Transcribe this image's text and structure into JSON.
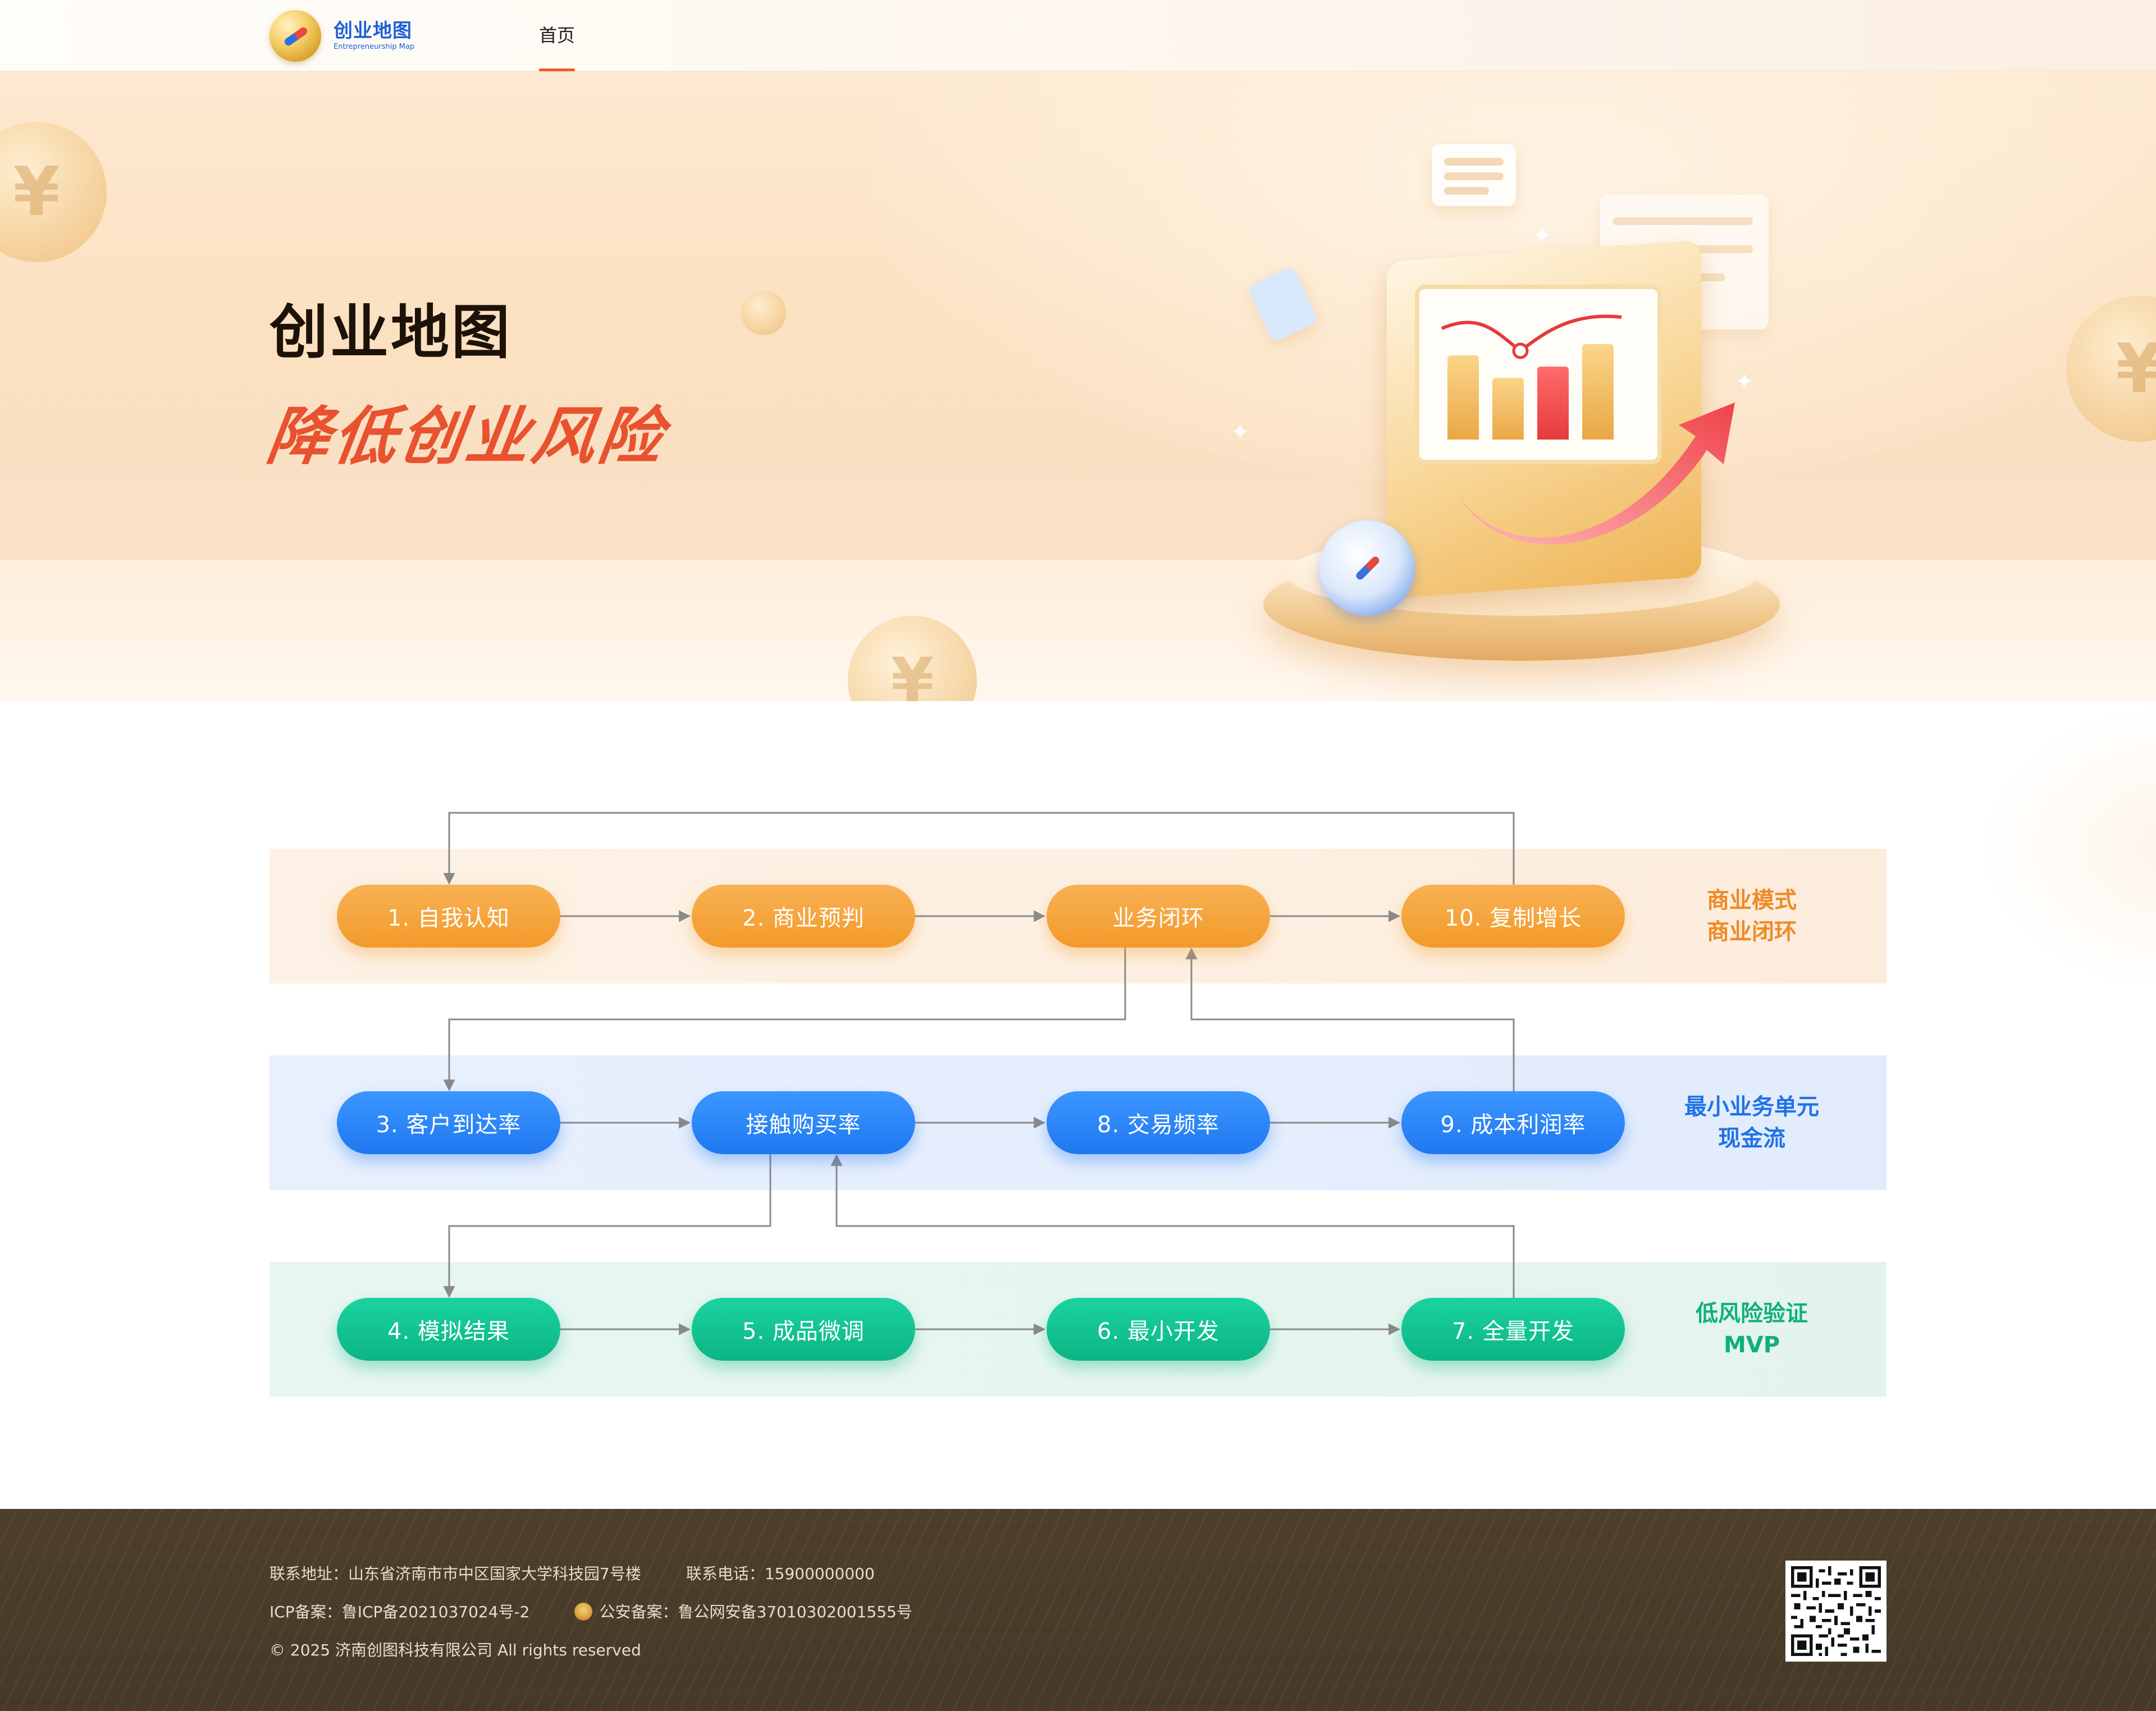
{
  "header": {
    "logo_title": "创业地图",
    "logo_subtitle": "Entrepreneurship Map",
    "nav_home": "首页"
  },
  "hero": {
    "title": "创业地图",
    "subtitle": "降低创业风险"
  },
  "flow": {
    "rows": [
      {
        "color": "#f29a2a",
        "nodes": [
          "1. 自我认知",
          "2. 商业预判",
          "业务闭环",
          "10. 复制增长"
        ],
        "label_line1": "商业模式",
        "label_line2": "商业闭环"
      },
      {
        "color": "#1f78f0",
        "nodes": [
          "3. 客户到达率",
          "接触购买率",
          "8. 交易频率",
          "9. 成本利润率"
        ],
        "label_line1": "最小业务单元",
        "label_line2": "现金流"
      },
      {
        "color": "#0bb584",
        "nodes": [
          "4. 模拟结果",
          "5. 成品微调",
          "6. 最小开发",
          "7. 全量开发"
        ],
        "label_line1": "低风险验证",
        "label_line2": "MVP"
      }
    ]
  },
  "footer": {
    "address": "联系地址：山东省济南市市中区国家大学科技园7号楼",
    "phone": "联系电话：15900000000",
    "icp": "ICP备案：鲁ICP备2021037024号-2",
    "police": "公安备案：鲁公网安备37010302001555号",
    "copyright": "© 2025 济南创图科技有限公司 All rights reserved"
  }
}
